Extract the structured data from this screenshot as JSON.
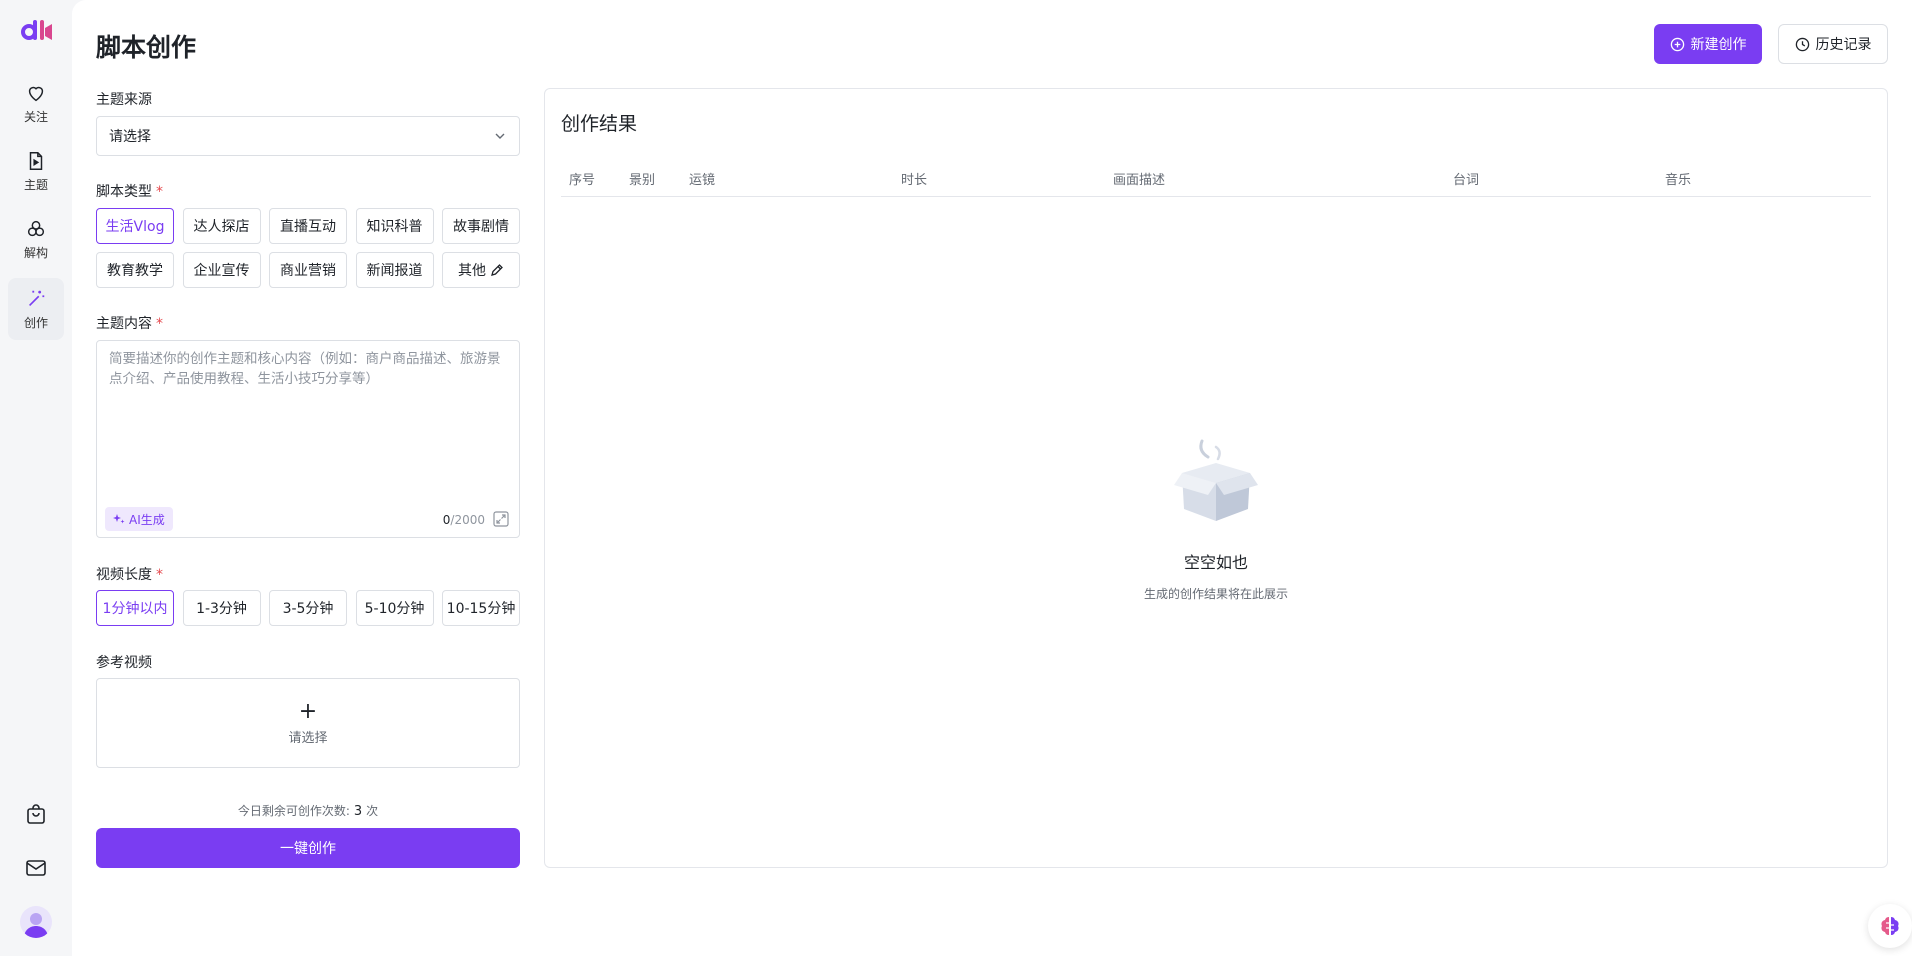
{
  "colors": {
    "accent": "#7a3df2",
    "required": "#e5484d"
  },
  "sidebar": {
    "logo": "dl-logo",
    "items": [
      {
        "label": "关注",
        "icon": "heart-icon"
      },
      {
        "label": "主题",
        "icon": "video-file-icon"
      },
      {
        "label": "解构",
        "icon": "circles-icon"
      },
      {
        "label": "创作",
        "icon": "magic-wand-icon",
        "active": true
      }
    ],
    "bottom_icons": [
      "shopping-bag-icon",
      "mail-icon",
      "avatar"
    ]
  },
  "header": {
    "title": "脚本创作",
    "new_button": "新建创作",
    "history_button": "历史记录"
  },
  "form": {
    "topic_source": {
      "label": "主题来源",
      "value": "请选择"
    },
    "script_type": {
      "label": "脚本类型",
      "required": "*",
      "options": [
        "生活Vlog",
        "达人探店",
        "直播互动",
        "知识科普",
        "故事剧情",
        "教育教学",
        "企业宣传",
        "商业营销",
        "新闻报道",
        "其他"
      ],
      "selected": "生活Vlog"
    },
    "topic_content": {
      "label": "主题内容",
      "required": "*",
      "placeholder": "简要描述你的创作主题和核心内容（例如：商户商品描述、旅游景点介绍、产品使用教程、生活小技巧分享等）",
      "value": "",
      "ai_button": "AI生成",
      "count": "0",
      "max": "/2000"
    },
    "video_length": {
      "label": "视频长度",
      "required": "*",
      "options": [
        "1分钟以内",
        "1-3分钟",
        "3-5分钟",
        "5-10分钟",
        "10-15分钟"
      ],
      "selected": "1分钟以内"
    },
    "reference_video": {
      "label": "参考视频",
      "placeholder": "请选择"
    },
    "remaining": {
      "prefix": "今日剩余可创作次数:",
      "count": "3",
      "suffix": "次"
    },
    "submit": "一键创作"
  },
  "result": {
    "title": "创作结果",
    "columns": [
      "序号",
      "景别",
      "运镜",
      "时长",
      "画面描述",
      "台词",
      "音乐"
    ],
    "empty_title": "空空如也",
    "empty_subtitle": "生成的创作结果将在此展示"
  }
}
